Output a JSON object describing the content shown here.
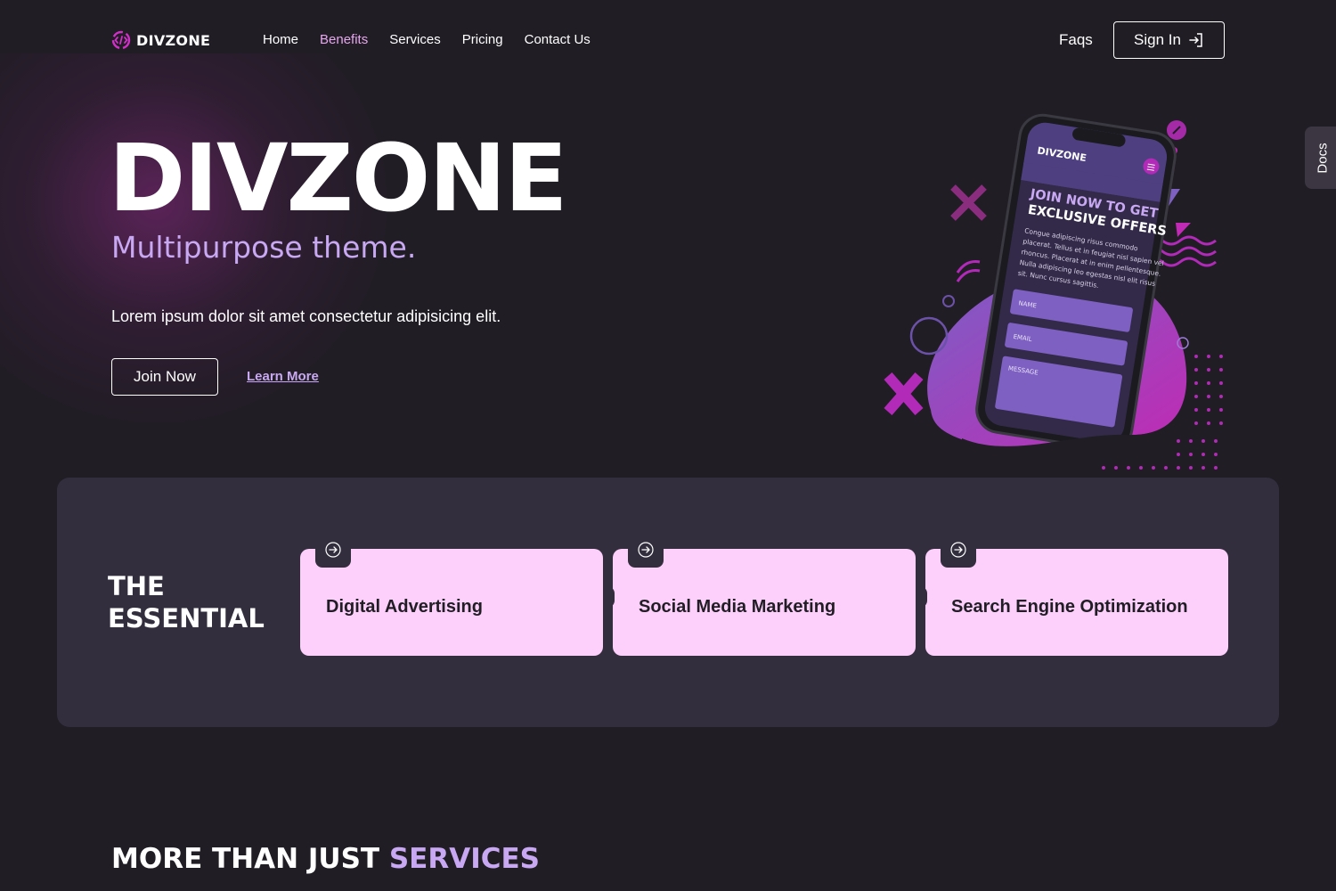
{
  "brand": {
    "name": "DIVZONE"
  },
  "nav": {
    "links": [
      {
        "label": "Home",
        "active": false
      },
      {
        "label": "Benefits",
        "active": true
      },
      {
        "label": "Services",
        "active": false
      },
      {
        "label": "Pricing",
        "active": false
      },
      {
        "label": "Contact Us",
        "active": false
      }
    ],
    "faqs_label": "Faqs",
    "signin_label": "Sign In"
  },
  "hero": {
    "title": "DIVZONE",
    "subtitle": "Multipurpose theme.",
    "description": "Lorem ipsum dolor sit amet consectetur adipisicing elit.",
    "join_label": "Join Now",
    "learn_label": "Learn More",
    "phone": {
      "brand": "DIVZONE",
      "headline_1": "JOIN NOW TO GET",
      "headline_2": "EXCLUSIVE OFFERS",
      "body_lines": [
        "Congue adipiscing risus commodo",
        "placerat. Tellus et in feugiat nisl sapien vel",
        "rhoncus. Placerat at in enim pellentesque.",
        "Nulla adipiscing leo egestas nisl elit risus",
        "sit. Nunc cursus sagittis."
      ],
      "fields": [
        "NAME",
        "EMAIL",
        "MESSAGE"
      ]
    }
  },
  "docs_tab": {
    "label": "Docs"
  },
  "essential": {
    "title_line1": "THE",
    "title_line2": "ESSENTIAL",
    "cards": [
      {
        "title": "Digital Advertising",
        "icon": "arrow-right-icon"
      },
      {
        "title": "Social Media Marketing",
        "icon": "arrow-right-icon"
      },
      {
        "title": "Search Engine Optimization",
        "icon": "arrow-right-icon"
      }
    ]
  },
  "more": {
    "prefix": "MORE THAN JUST ",
    "accent": "SERVICES"
  },
  "colors": {
    "background": "#211d25",
    "panel": "#332e3d",
    "accent_lavender": "#c8a8f2",
    "accent_pink": "#e6a7ef",
    "card": "#fdd0fb",
    "magenta": "#b12ab8",
    "purple": "#7e5fc2"
  }
}
